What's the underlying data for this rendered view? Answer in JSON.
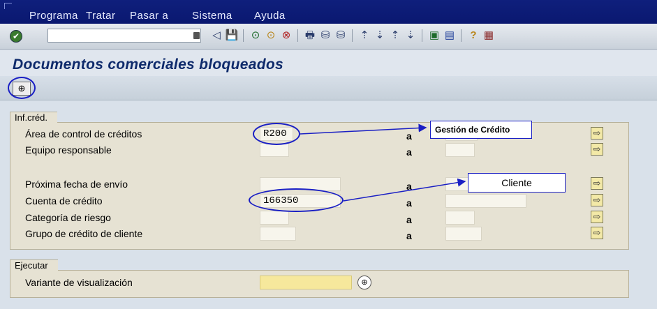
{
  "menu": [
    "Programa",
    "Tratar",
    "Pasar a",
    "Sistema",
    "Ayuda"
  ],
  "toolbar": {
    "ok_icon": "✔",
    "icons": [
      "◁",
      "💾",
      "⊙",
      "⊙",
      "⊗",
      "🖶",
      "⛁",
      "⛁",
      "⇡",
      "⇣",
      "⇡",
      "⇣",
      "▣",
      "▤",
      "?",
      "▦"
    ]
  },
  "page": {
    "title": "Documentos comerciales bloqueados"
  },
  "apptoolbar": {
    "execute_icon": "⊕"
  },
  "groups": {
    "credit": {
      "title": "Inf.créd.",
      "rows": [
        {
          "label": "Área de control de créditos",
          "from": "R200",
          "to": "",
          "a": "a"
        },
        {
          "label": "Equipo responsable",
          "from": "",
          "to": "",
          "a": "a"
        },
        {
          "label": "Próxima fecha de envío",
          "from": "",
          "to": "",
          "a": "a"
        },
        {
          "label": "Cuenta de crédito",
          "from": "166350",
          "to": "",
          "a": "a"
        },
        {
          "label": "Categoría de riesgo",
          "from": "",
          "to": "",
          "a": "a"
        },
        {
          "label": "Grupo de crédito de cliente",
          "from": "",
          "to": "",
          "a": "a"
        }
      ]
    },
    "execute": {
      "title": "Ejecutar",
      "variant_label": "Variante de visualización",
      "variant_value": ""
    }
  },
  "annotations": {
    "callout_area": "Gestión de Crédito",
    "callout_account": "Cliente"
  },
  "colors": {
    "menubar": "#0f1f7c",
    "title": "#0e2a6b",
    "annotation": "#1a1fc4",
    "group_bg": "#e6e2d3",
    "required_field": "#f6e89c"
  }
}
